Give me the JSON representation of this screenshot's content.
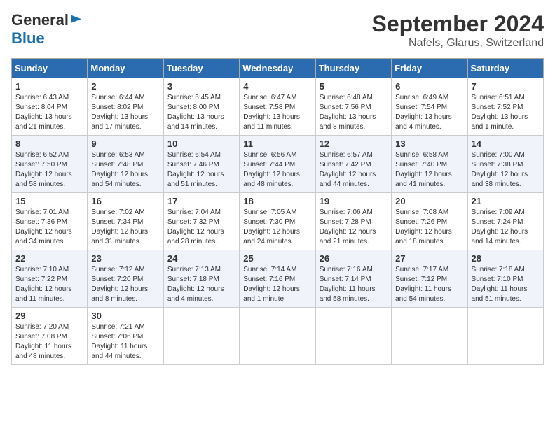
{
  "header": {
    "logo_general": "General",
    "logo_blue": "Blue",
    "month": "September 2024",
    "location": "Nafels, Glarus, Switzerland"
  },
  "days_of_week": [
    "Sunday",
    "Monday",
    "Tuesday",
    "Wednesday",
    "Thursday",
    "Friday",
    "Saturday"
  ],
  "weeks": [
    [
      {
        "day": 1,
        "info": "Sunrise: 6:43 AM\nSunset: 8:04 PM\nDaylight: 13 hours\nand 21 minutes."
      },
      {
        "day": 2,
        "info": "Sunrise: 6:44 AM\nSunset: 8:02 PM\nDaylight: 13 hours\nand 17 minutes."
      },
      {
        "day": 3,
        "info": "Sunrise: 6:45 AM\nSunset: 8:00 PM\nDaylight: 13 hours\nand 14 minutes."
      },
      {
        "day": 4,
        "info": "Sunrise: 6:47 AM\nSunset: 7:58 PM\nDaylight: 13 hours\nand 11 minutes."
      },
      {
        "day": 5,
        "info": "Sunrise: 6:48 AM\nSunset: 7:56 PM\nDaylight: 13 hours\nand 8 minutes."
      },
      {
        "day": 6,
        "info": "Sunrise: 6:49 AM\nSunset: 7:54 PM\nDaylight: 13 hours\nand 4 minutes."
      },
      {
        "day": 7,
        "info": "Sunrise: 6:51 AM\nSunset: 7:52 PM\nDaylight: 13 hours\nand 1 minute."
      }
    ],
    [
      {
        "day": 8,
        "info": "Sunrise: 6:52 AM\nSunset: 7:50 PM\nDaylight: 12 hours\nand 58 minutes."
      },
      {
        "day": 9,
        "info": "Sunrise: 6:53 AM\nSunset: 7:48 PM\nDaylight: 12 hours\nand 54 minutes."
      },
      {
        "day": 10,
        "info": "Sunrise: 6:54 AM\nSunset: 7:46 PM\nDaylight: 12 hours\nand 51 minutes."
      },
      {
        "day": 11,
        "info": "Sunrise: 6:56 AM\nSunset: 7:44 PM\nDaylight: 12 hours\nand 48 minutes."
      },
      {
        "day": 12,
        "info": "Sunrise: 6:57 AM\nSunset: 7:42 PM\nDaylight: 12 hours\nand 44 minutes."
      },
      {
        "day": 13,
        "info": "Sunrise: 6:58 AM\nSunset: 7:40 PM\nDaylight: 12 hours\nand 41 minutes."
      },
      {
        "day": 14,
        "info": "Sunrise: 7:00 AM\nSunset: 7:38 PM\nDaylight: 12 hours\nand 38 minutes."
      }
    ],
    [
      {
        "day": 15,
        "info": "Sunrise: 7:01 AM\nSunset: 7:36 PM\nDaylight: 12 hours\nand 34 minutes."
      },
      {
        "day": 16,
        "info": "Sunrise: 7:02 AM\nSunset: 7:34 PM\nDaylight: 12 hours\nand 31 minutes."
      },
      {
        "day": 17,
        "info": "Sunrise: 7:04 AM\nSunset: 7:32 PM\nDaylight: 12 hours\nand 28 minutes."
      },
      {
        "day": 18,
        "info": "Sunrise: 7:05 AM\nSunset: 7:30 PM\nDaylight: 12 hours\nand 24 minutes."
      },
      {
        "day": 19,
        "info": "Sunrise: 7:06 AM\nSunset: 7:28 PM\nDaylight: 12 hours\nand 21 minutes."
      },
      {
        "day": 20,
        "info": "Sunrise: 7:08 AM\nSunset: 7:26 PM\nDaylight: 12 hours\nand 18 minutes."
      },
      {
        "day": 21,
        "info": "Sunrise: 7:09 AM\nSunset: 7:24 PM\nDaylight: 12 hours\nand 14 minutes."
      }
    ],
    [
      {
        "day": 22,
        "info": "Sunrise: 7:10 AM\nSunset: 7:22 PM\nDaylight: 12 hours\nand 11 minutes."
      },
      {
        "day": 23,
        "info": "Sunrise: 7:12 AM\nSunset: 7:20 PM\nDaylight: 12 hours\nand 8 minutes."
      },
      {
        "day": 24,
        "info": "Sunrise: 7:13 AM\nSunset: 7:18 PM\nDaylight: 12 hours\nand 4 minutes."
      },
      {
        "day": 25,
        "info": "Sunrise: 7:14 AM\nSunset: 7:16 PM\nDaylight: 12 hours\nand 1 minute."
      },
      {
        "day": 26,
        "info": "Sunrise: 7:16 AM\nSunset: 7:14 PM\nDaylight: 11 hours\nand 58 minutes."
      },
      {
        "day": 27,
        "info": "Sunrise: 7:17 AM\nSunset: 7:12 PM\nDaylight: 11 hours\nand 54 minutes."
      },
      {
        "day": 28,
        "info": "Sunrise: 7:18 AM\nSunset: 7:10 PM\nDaylight: 11 hours\nand 51 minutes."
      }
    ],
    [
      {
        "day": 29,
        "info": "Sunrise: 7:20 AM\nSunset: 7:08 PM\nDaylight: 11 hours\nand 48 minutes."
      },
      {
        "day": 30,
        "info": "Sunrise: 7:21 AM\nSunset: 7:06 PM\nDaylight: 11 hours\nand 44 minutes."
      },
      null,
      null,
      null,
      null,
      null
    ]
  ]
}
